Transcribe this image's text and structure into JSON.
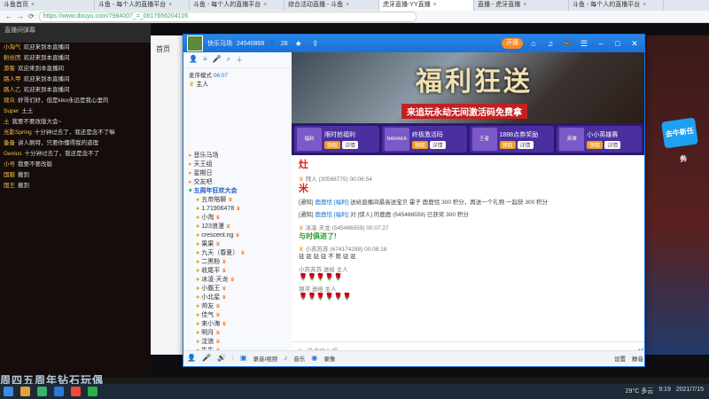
{
  "browser": {
    "tabs": [
      {
        "label": "斗鱼首页",
        "active": false
      },
      {
        "label": "斗鱼 - 每个人的直播平台",
        "active": false
      },
      {
        "label": "斗鱼 - 每个人的直播平台",
        "active": false
      },
      {
        "label": "综合活动直播 - 斗鱼",
        "active": false
      },
      {
        "label": "虎牙直播-YY直播",
        "active": true
      },
      {
        "label": "直播 - 虎牙直播",
        "active": false
      },
      {
        "label": "斗鱼 - 每个人的直播平台",
        "active": false
      }
    ],
    "url": "https://www.douyu.com/7984007_=_0617656204105"
  },
  "left_panel": {
    "header": "直播间弹幕",
    "messages": [
      {
        "user": "小淘气",
        "text": "欢迎来到本直播间"
      },
      {
        "user": "粉丝团",
        "text": "欢迎来到本直播间"
      },
      {
        "user": "游客",
        "text": "欢迎来到本直播间"
      },
      {
        "user": "路人甲",
        "text": "欢迎来到本直播间"
      },
      {
        "user": "路人乙",
        "text": "欢迎来到本直播间"
      },
      {
        "user": "观众",
        "text": "好哥们好，但是kiko永远是我心里的"
      },
      {
        "user": "Super",
        "text": "土土"
      },
      {
        "user": "土",
        "text": "我要不要改版大会~"
      },
      {
        "user": "光影Spring",
        "text": "十分钟过去了，我还是念不了嘛"
      },
      {
        "user": "备备",
        "text": "讲人刷特，只要你懂得我的道理"
      },
      {
        "user": "Genius",
        "text": "十分钟过去了，我还是念不了"
      },
      {
        "user": "小号",
        "text": "我要不要改版"
      },
      {
        "user": "国服",
        "text": "搬到"
      },
      {
        "user": "国王",
        "text": "搬到"
      }
    ],
    "combo": [
      "x10",
      "x4"
    ],
    "bottom_text": "周四五周年钻石玩偶"
  },
  "mid_page_label": "首页",
  "badge_text": "去牛新任务",
  "yy": {
    "title_icons": [
      "快乐马场"
    ],
    "room_id": "24540869",
    "room_count": "28",
    "pill_label": "开播",
    "sidebar": {
      "mode_label": "麦序模式",
      "mode_time": "06:07",
      "top_user": "主人",
      "groups": [
        "音乐马场",
        "天王组",
        "星期日",
        "交友吧"
      ],
      "channel": "五周年狂欢大会",
      "members": [
        "五帝陪聊",
        "1.71906478",
        "小淘",
        "123浪漫",
        "crescent.ng",
        "果果",
        "九天（春夏）",
        "二黑粉",
        "收尾平",
        "冰凌·天龙",
        "小霸王",
        "小北星",
        "帅友",
        "佳气",
        "来小海",
        "明月",
        "沈浪",
        "牛牛"
      ]
    },
    "banner": {
      "title": "福利狂送",
      "subtitle": "来追玩永劫无间激活码免费拿"
    },
    "cards": [
      {
        "thumb": "福利",
        "title": "限时抢福利",
        "b1": "领取",
        "b2": "详情"
      },
      {
        "thumb": "NARAKA",
        "title": "终极激活码",
        "b1": "领取",
        "b2": "详情"
      },
      {
        "thumb": "王者",
        "title": "1888点券奖励",
        "b1": "领取",
        "b2": "详情"
      },
      {
        "thumb": "英雄",
        "title": "小小英雄赛",
        "b1": "领取",
        "b2": "详情"
      }
    ],
    "chat": {
      "big1": "灶",
      "head1": "拜人 (30568775)  00:06:54",
      "big2": "米",
      "sys1_prefix": "[通知]",
      "sys1_blue": "鹿鹿恬 [福利]",
      "sys1_rest": "送给直播间最高送宝贝 霍子 鹿鹿恬 300 积分，再送一个礼物 一起获 300 积分",
      "sys2_prefix": "[通知]",
      "sys2_blue": "鹿鹿恬 [福利]",
      "sys2_rest": "对 [惊人] 的鹿鹿 (545486559) 已获奖 300 积分",
      "head2": "冰凌·天龙 (545486559)  00:07:27",
      "green": "与时俱进了!",
      "head3": "小苏苏苏 (674174288)  00:08:18",
      "line3": "驻 驻 驻 驻    不 限 驻 驻",
      "head4": "小苏苏苏 送给 主人",
      "roses": "🌹🌹🌹🌹🌹",
      "head5": "银河 送给 主人",
      "roses2": "🌹🌹🌹🌹🌹🌹"
    },
    "input_placeholder": "说点什么吧...",
    "bottom_bar": [
      "录音/视频",
      "音乐",
      "录像",
      "设置",
      "静音"
    ]
  },
  "taskbar": {
    "weather": "29°C 多云",
    "time": "9:19",
    "date": "2021/7/15"
  }
}
